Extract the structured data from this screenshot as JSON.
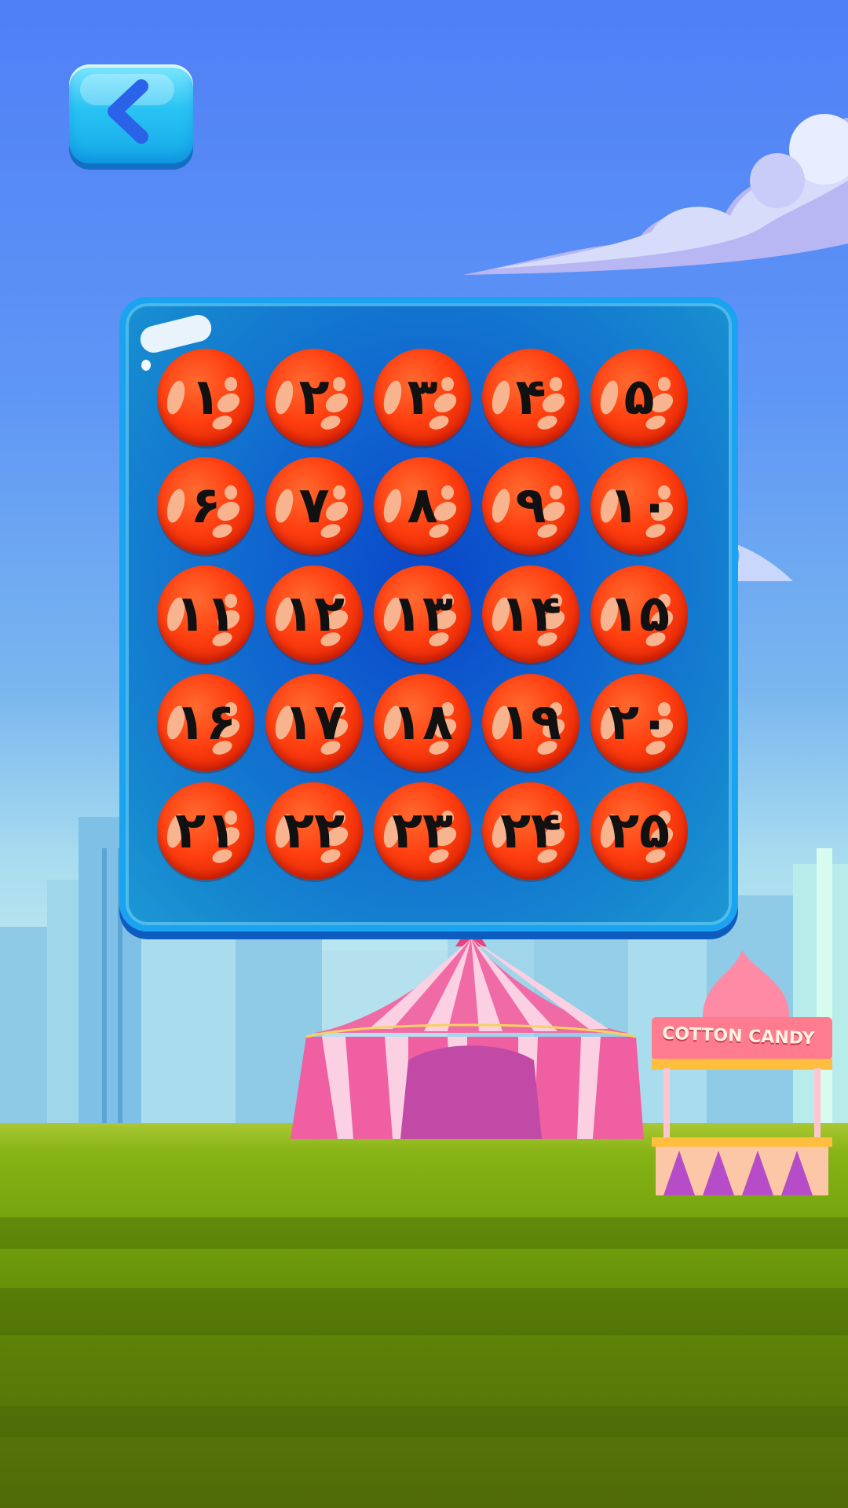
{
  "back_button": {
    "icon": "chevron-left-icon"
  },
  "level_grid": {
    "levels": [
      "١",
      "٢",
      "٣",
      "۴",
      "۵",
      "۶",
      "٧",
      "٨",
      "٩",
      "١٠",
      "١١",
      "١٢",
      "١٣",
      "١۴",
      "١۵",
      "١۶",
      "١٧",
      "١٨",
      "١٩",
      "٢٠",
      "٢١",
      "٢٢",
      "٢٣",
      "٢۴",
      "٢۵"
    ]
  },
  "stall": {
    "sign": "COTTON CANDY"
  },
  "colors": {
    "panel": "#1687cf",
    "level_bubble": "#ff3f10",
    "back_button": "#29c3f3"
  }
}
